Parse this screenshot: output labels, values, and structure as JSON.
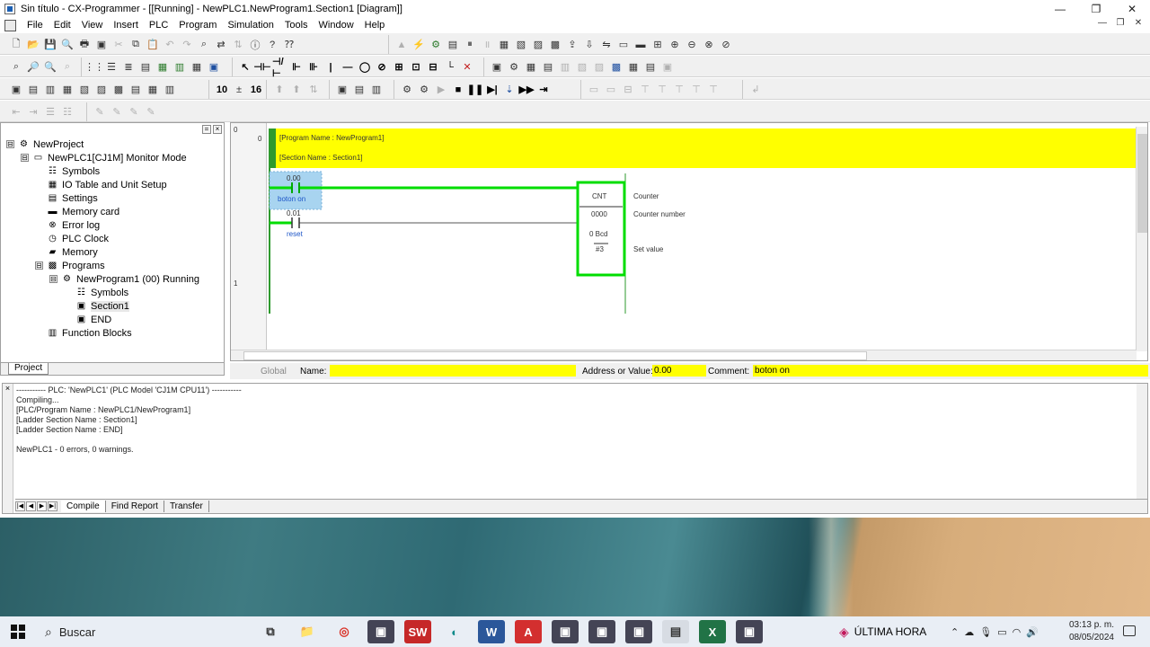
{
  "window": {
    "title": "Sin título - CX-Programmer - [[Running] - NewPLC1.NewProgram1.Section1 [Diagram]]",
    "controls": [
      "—",
      "❐",
      "✕"
    ]
  },
  "menu": {
    "items": [
      "File",
      "Edit",
      "View",
      "Insert",
      "PLC",
      "Program",
      "Simulation",
      "Tools",
      "Window",
      "Help"
    ],
    "mdi_controls": [
      "—",
      "❐",
      "✕"
    ]
  },
  "project_tree": {
    "tab_label": "Project",
    "items": [
      {
        "label": "NewProject",
        "level": 0,
        "expander": "⊟",
        "icon": "project-icon"
      },
      {
        "label": "NewPLC1[CJ1M] Monitor Mode",
        "level": 1,
        "expander": "⊟",
        "icon": "plc-icon"
      },
      {
        "label": "Symbols",
        "level": 2,
        "expander": "",
        "icon": "symbols-icon"
      },
      {
        "label": "IO Table and Unit Setup",
        "level": 2,
        "expander": "",
        "icon": "io-table-icon"
      },
      {
        "label": "Settings",
        "level": 2,
        "expander": "",
        "icon": "settings-icon"
      },
      {
        "label": "Memory card",
        "level": 2,
        "expander": "",
        "icon": "memory-card-icon"
      },
      {
        "label": "Error log",
        "level": 2,
        "expander": "",
        "icon": "error-log-icon"
      },
      {
        "label": "PLC Clock",
        "level": 2,
        "expander": "",
        "icon": "clock-icon"
      },
      {
        "label": "Memory",
        "level": 2,
        "expander": "",
        "icon": "memory-icon"
      },
      {
        "label": "Programs",
        "level": 2,
        "expander": "⊟",
        "icon": "programs-icon"
      },
      {
        "label": "NewProgram1 (00) Running",
        "level": 3,
        "expander": "⊟",
        "icon": "program-icon"
      },
      {
        "label": "Symbols",
        "level": 4,
        "expander": "",
        "icon": "symbols-icon"
      },
      {
        "label": "Section1",
        "level": 4,
        "expander": "",
        "icon": "section-icon",
        "selected": true
      },
      {
        "label": "END",
        "level": 4,
        "expander": "",
        "icon": "section-icon"
      },
      {
        "label": "Function Blocks",
        "level": 2,
        "expander": "",
        "icon": "function-blocks-icon"
      }
    ]
  },
  "ladder": {
    "rung_numbers": [
      "0",
      "1"
    ],
    "step_numbers": [
      "0"
    ],
    "program_name": "[Program Name : NewProgram1]",
    "section_name": "[Section Name : Section1]",
    "contact1": {
      "address": "0.00",
      "comment": "boton on"
    },
    "contact2": {
      "address": "0.01",
      "comment": "reset"
    },
    "instruction": {
      "mnemonic": "CNT",
      "counter": "0000",
      "set_value_label": "0 Bcd",
      "set_value": "#3"
    },
    "operand_comments": [
      "Counter",
      "Counter number",
      "Set value"
    ],
    "colors": {
      "banner": "#ffff00",
      "powered": "#00dd00",
      "rail": "#2e9a2e",
      "selected": "#a8d4f0"
    }
  },
  "info_bar": {
    "scope": "Global",
    "name_label": "Name:",
    "name_value": "",
    "address_label": "Address or Value:",
    "address_value": "0.00",
    "comment_label": "Comment:",
    "comment_value": "boton on"
  },
  "output": {
    "header": "----------- PLC: 'NewPLC1' (PLC Model 'CJ1M CPU11') -----------",
    "lines": [
      "Compiling...",
      "[PLC/Program Name : NewPLC1/NewProgram1]",
      "[Ladder Section Name : Section1]",
      "[Ladder Section Name : END]",
      "",
      "NewPLC1 - 0 errors, 0 warnings."
    ],
    "tabs": [
      "Compile",
      "Find Report",
      "Transfer"
    ]
  },
  "taskbar": {
    "search_placeholder": "Buscar",
    "news": "ÚLTIMA HORA",
    "time": "03:13 p. m.",
    "date": "08/05/2024",
    "apps": [
      "task-view-icon",
      "file-explorer-icon",
      "chrome-icon",
      "app-icon",
      "solidworks-icon",
      "edge-icon",
      "word-icon",
      "acrobat-icon",
      "app-icon",
      "app-icon",
      "app-icon",
      "cx-programmer-icon",
      "excel-icon",
      "app-icon"
    ]
  }
}
